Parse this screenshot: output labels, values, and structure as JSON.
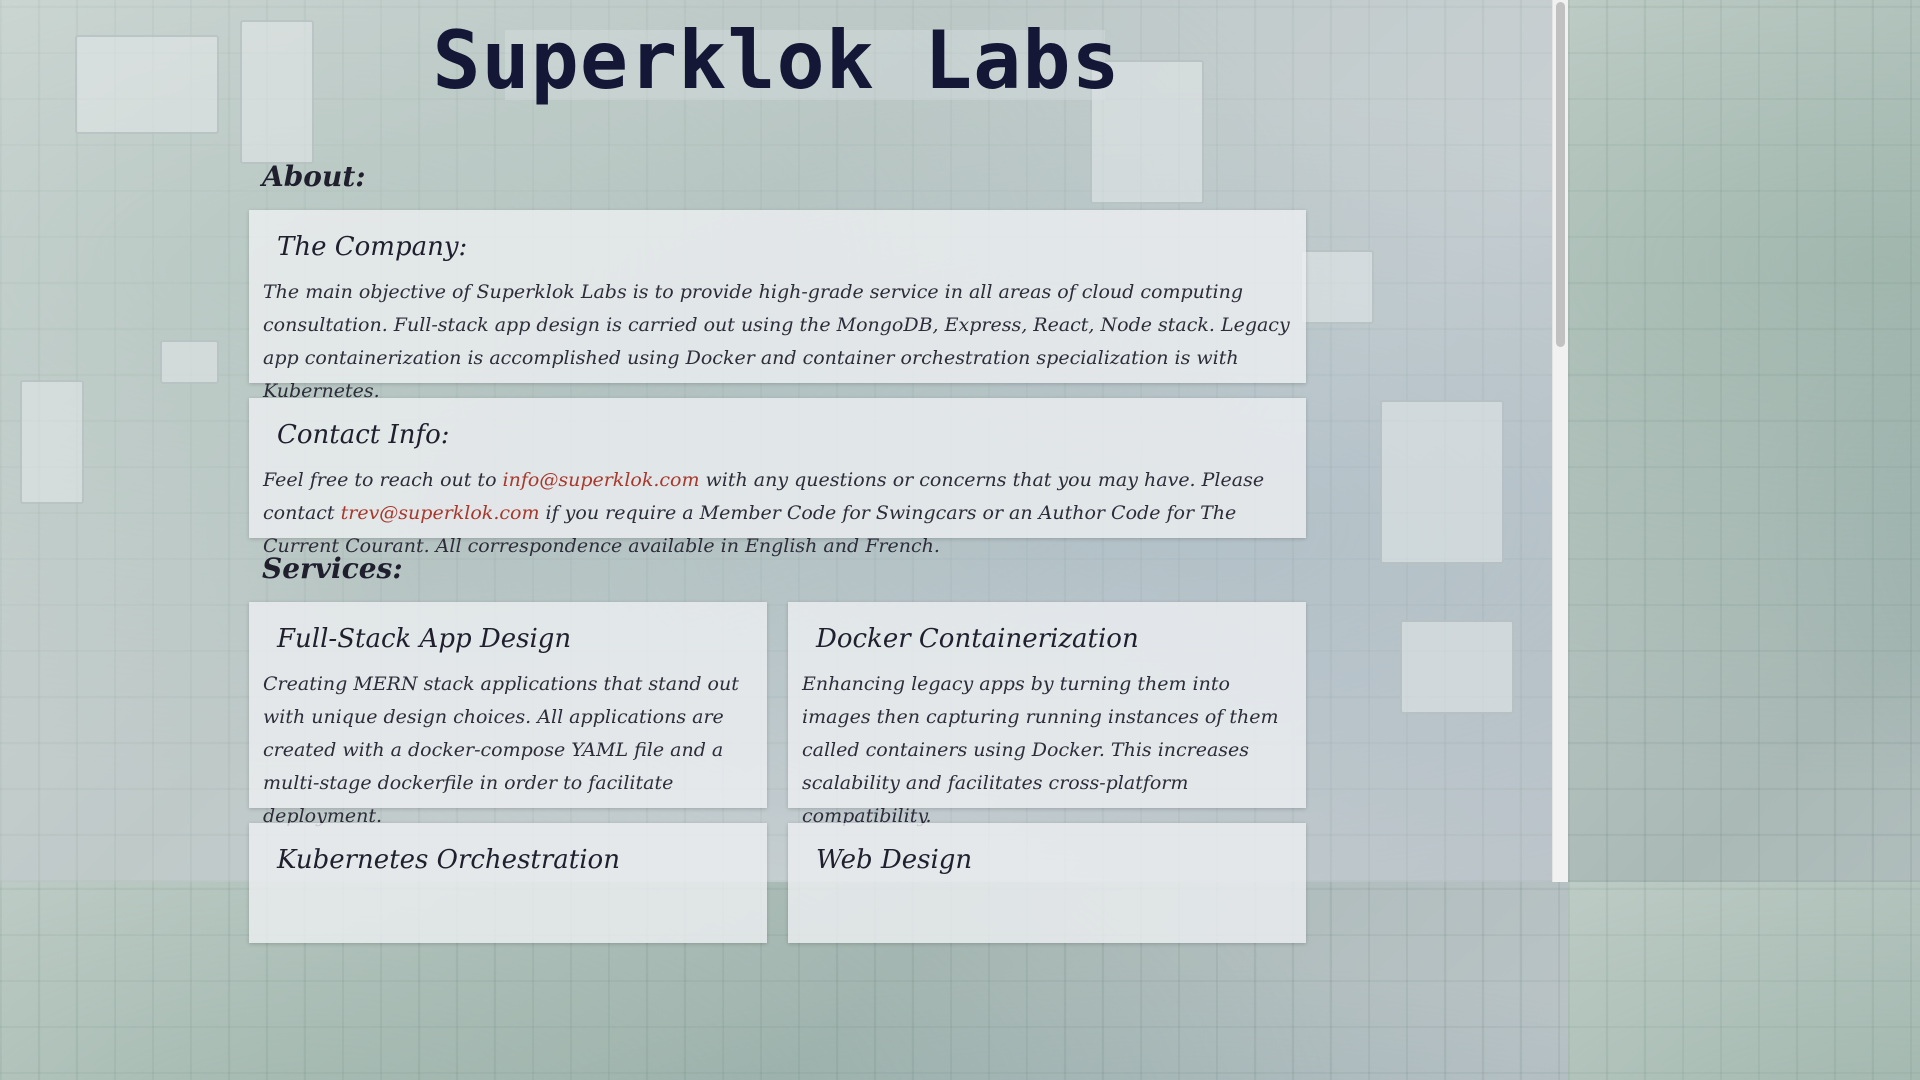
{
  "site": {
    "title": "Superklok Labs"
  },
  "about": {
    "heading": "About:",
    "company": {
      "title": "The Company:",
      "text": "The main objective of Superklok Labs is to provide high-grade service in all areas of cloud computing consultation. Full-stack app design is carried out using the MongoDB, Express, React, Node stack. Legacy app containerization is accomplished using Docker and container orchestration specialization is with Kubernetes."
    },
    "contact": {
      "title": "Contact Info:",
      "text_before": "Feel free to reach out to ",
      "email_info": "info@superklok.com",
      "text_middle": " with any questions or concerns that you may have. Please contact ",
      "email_trev": "trev@superklok.com",
      "text_after": " if you require a Member Code for Swingcars or an Author Code for The Current Courant. All correspondence available in English and French."
    }
  },
  "services": {
    "heading": "Services:",
    "items": [
      {
        "title": "Full-Stack App Design",
        "text": "Creating MERN stack applications that stand out with unique design choices. All applications are created with a docker-compose YAML file and a multi-stage dockerfile in order to facilitate deployment."
      },
      {
        "title": "Docker Containerization",
        "text": "Enhancing legacy apps by turning them into images then capturing running instances of them called containers using Docker. This increases scalability and facilitates cross-platform compatibility."
      },
      {
        "title": "Kubernetes Orchestration",
        "text": ""
      },
      {
        "title": "Web Design",
        "text": ""
      }
    ]
  },
  "colors": {
    "title": "#141735",
    "link": "#a8382c",
    "card_bg": "#eceef0"
  }
}
